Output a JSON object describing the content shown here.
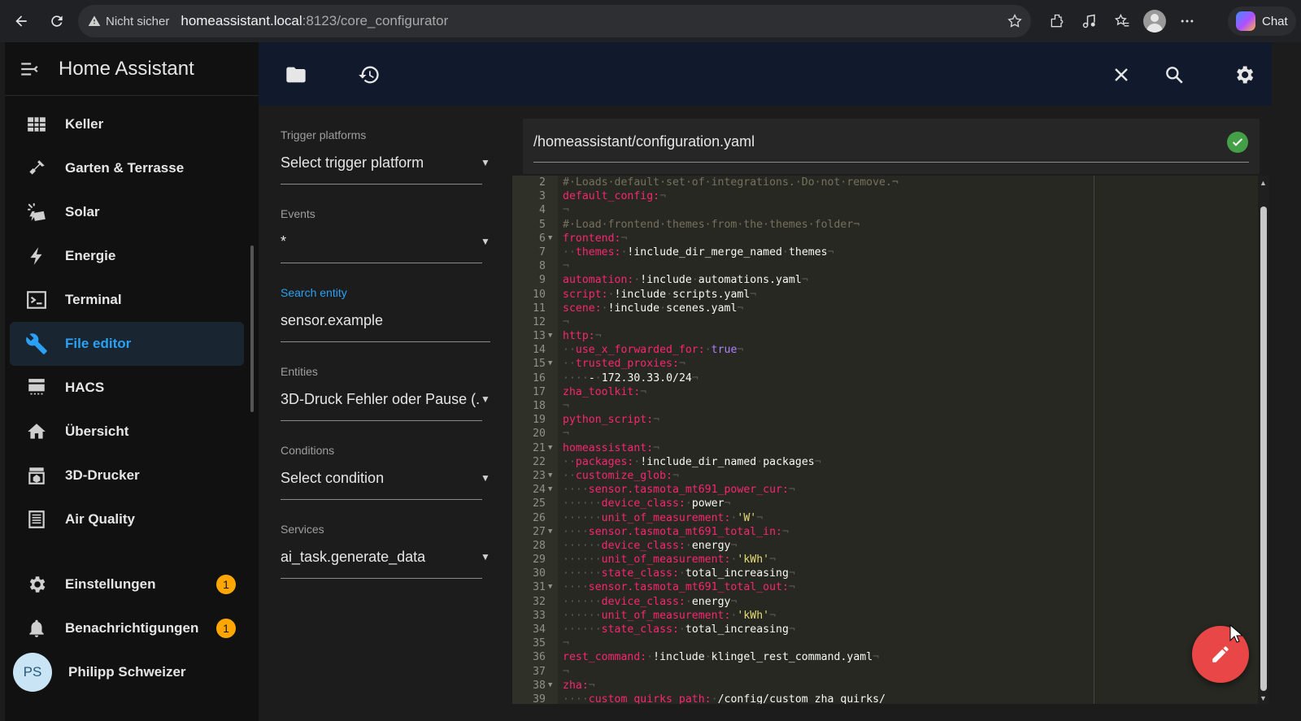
{
  "browser": {
    "security_label": "Nicht sicher",
    "url_host": "homeassistant.local",
    "url_path": ":8123/core_configurator",
    "chat_label": "Chat"
  },
  "sidebar": {
    "title": "Home Assistant",
    "items": [
      {
        "label": "Keller",
        "icon": "floorplan-icon"
      },
      {
        "label": "Garten & Terrasse",
        "icon": "shovel-icon"
      },
      {
        "label": "Solar",
        "icon": "solar-power-icon"
      },
      {
        "label": "Energie",
        "icon": "lightning-icon"
      },
      {
        "label": "Terminal",
        "icon": "console-icon"
      },
      {
        "label": "File editor",
        "icon": "wrench-icon",
        "active": true
      },
      {
        "label": "HACS",
        "icon": "hacs-icon"
      },
      {
        "label": "Übersicht",
        "icon": "home-icon"
      },
      {
        "label": "3D-Drucker",
        "icon": "printer-3d-icon"
      },
      {
        "label": "Air Quality",
        "icon": "air-filter-icon"
      }
    ],
    "settings_label": "Einstellungen",
    "settings_badge": "1",
    "notifications_label": "Benachrichtigungen",
    "notifications_badge": "1",
    "user_initials": "PS",
    "user_name": "Philipp Schweizer"
  },
  "panel": {
    "fields": [
      {
        "label": "Trigger platforms",
        "value": "Select trigger platform"
      },
      {
        "label": "Events",
        "value": "*"
      },
      {
        "label": "Search entity",
        "value": "sensor.example"
      },
      {
        "label": "Entities",
        "value": "3D-Druck Fehler oder Pause (..."
      },
      {
        "label": "Conditions",
        "value": "Select condition"
      },
      {
        "label": "Services",
        "value": "ai_task.generate_data"
      }
    ]
  },
  "file": {
    "path": "/homeassistant/configuration.yaml"
  },
  "editor": {
    "lines": [
      {
        "n": "2",
        "text": "#·Loads·default·set·of·integrations.·Do·not·remove.¬"
      },
      {
        "n": "3",
        "text": "default_config:¬"
      },
      {
        "n": "4",
        "text": "¬"
      },
      {
        "n": "5",
        "text": "#·Load·frontend·themes·from·the·themes·folder¬"
      },
      {
        "n": "6",
        "text": "frontend:¬",
        "fold": true
      },
      {
        "n": "7",
        "text": "··themes:·!include_dir_merge_named·themes¬"
      },
      {
        "n": "8",
        "text": "¬"
      },
      {
        "n": "9",
        "text": "automation:·!include·automations.yaml¬"
      },
      {
        "n": "10",
        "text": "script:·!include·scripts.yaml¬"
      },
      {
        "n": "11",
        "text": "scene:·!include·scenes.yaml¬"
      },
      {
        "n": "12",
        "text": "¬"
      },
      {
        "n": "13",
        "text": "http:¬",
        "fold": true
      },
      {
        "n": "14",
        "text": "··use_x_forwarded_for:·true¬"
      },
      {
        "n": "15",
        "text": "··trusted_proxies:¬",
        "fold": true
      },
      {
        "n": "16",
        "text": "····-·172.30.33.0/24¬"
      },
      {
        "n": "17",
        "text": "zha_toolkit:¬"
      },
      {
        "n": "18",
        "text": "¬"
      },
      {
        "n": "19",
        "text": "python_script:¬"
      },
      {
        "n": "20",
        "text": "¬"
      },
      {
        "n": "21",
        "text": "homeassistant:¬",
        "fold": true
      },
      {
        "n": "22",
        "text": "··packages:·!include_dir_named·packages¬"
      },
      {
        "n": "23",
        "text": "··customize_glob:¬",
        "fold": true
      },
      {
        "n": "24",
        "text": "····sensor.tasmota_mt691_power_cur:¬",
        "fold": true
      },
      {
        "n": "25",
        "text": "······device_class:·power¬"
      },
      {
        "n": "26",
        "text": "······unit_of_measurement:·'W'¬"
      },
      {
        "n": "27",
        "text": "····sensor.tasmota_mt691_total_in:¬",
        "fold": true
      },
      {
        "n": "28",
        "text": "······device_class:·energy¬"
      },
      {
        "n": "29",
        "text": "······unit_of_measurement:·'kWh'¬"
      },
      {
        "n": "30",
        "text": "······state_class:·total_increasing¬"
      },
      {
        "n": "31",
        "text": "····sensor.tasmota_mt691_total_out:¬",
        "fold": true
      },
      {
        "n": "32",
        "text": "······device_class:·energy¬"
      },
      {
        "n": "33",
        "text": "······unit_of_measurement:·'kWh'¬"
      },
      {
        "n": "34",
        "text": "······state_class:·total_increasing¬"
      },
      {
        "n": "35",
        "text": "¬"
      },
      {
        "n": "36",
        "text": "rest_command:·!include·klingel_rest_command.yaml¬"
      },
      {
        "n": "37",
        "text": "¬"
      },
      {
        "n": "38",
        "text": "zha:¬",
        "fold": true
      },
      {
        "n": "39",
        "text": "····custom_quirks_path:·/config/custom_zha_quirks/"
      }
    ]
  },
  "colors": {
    "accent": "#2aa1f5",
    "fab": "#e94747",
    "badge": "#ffa600",
    "success": "#43a047"
  }
}
